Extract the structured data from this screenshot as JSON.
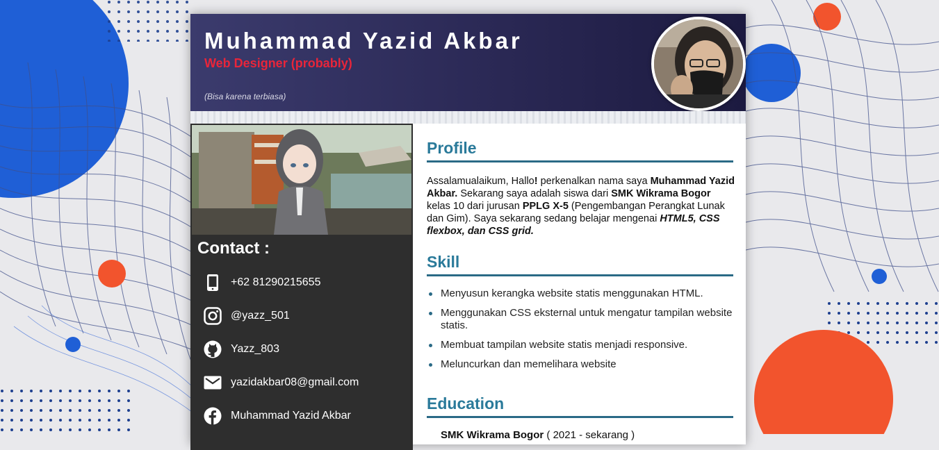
{
  "header": {
    "name": "Muhammad Yazid Akbar",
    "role": "Web Designer (probably)",
    "motto": "(Bisa karena terbiasa)"
  },
  "contact": {
    "title": "Contact :",
    "items": [
      {
        "icon": "phone-icon",
        "label": "+62 81290215655"
      },
      {
        "icon": "instagram-icon",
        "label": "@yazz_501"
      },
      {
        "icon": "github-icon",
        "label": "Yazz_803"
      },
      {
        "icon": "email-icon",
        "label": "yazidakbar08@gmail.com"
      },
      {
        "icon": "facebook-icon",
        "label": "Muhammad Yazid Akbar"
      }
    ]
  },
  "profile": {
    "title": "Profile",
    "t1": "Assalamualaikum, Hallo",
    "t2": "!",
    "t3": " perkenalkan nama saya ",
    "b1": "Muhammad Yazid Akbar.",
    "t4": " Sekarang saya adalah siswa dari ",
    "b2": "SMK Wikrama Bogor",
    "t5": " kelas 10 dari jurusan ",
    "b3": "PPLG X-5",
    "t6": " (Pengembangan Perangkat Lunak dan Gim). Saya sekarang sedang belajar mengenai ",
    "bi": "HTML5, CSS flexbox, dan CSS grid."
  },
  "skill": {
    "title": "Skill",
    "items": [
      "Menyusun kerangka website statis menggunakan HTML.",
      "Menggunakan CSS eksternal untuk mengatur tampilan website statis.",
      "Membuat tampilan website statis menjadi responsive.",
      "Meluncurkan dan memelihara website"
    ]
  },
  "education": {
    "title": "Education",
    "school": "SMK Wikrama Bogor",
    "years": "( 2021 - sekarang )"
  },
  "colors": {
    "accent": "#2a7a9a",
    "role_red": "#e8253a",
    "sidebar": "#2e2e2e",
    "header_start": "#3b3b6d",
    "header_end": "#1c1a40"
  }
}
